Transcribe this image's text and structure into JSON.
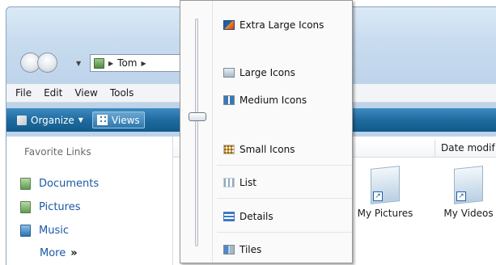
{
  "navigation": {
    "address_crumbs": [
      "Tom"
    ]
  },
  "menubar": {
    "items": [
      "File",
      "Edit",
      "View",
      "Tools"
    ]
  },
  "commandbar": {
    "organize_label": "Organize",
    "views_label": "Views"
  },
  "left_pane": {
    "header": "Favorite Links",
    "links": [
      "Documents",
      "Pictures",
      "Music"
    ],
    "more_label": "More",
    "more_arrow": "»"
  },
  "main_pane": {
    "column_date_label": "Date modif",
    "files": [
      "My Pictures",
      "My Videos"
    ]
  },
  "views_menu": {
    "items": [
      {
        "label": "Extra Large Icons",
        "icon": "extra-large-icons-icon"
      },
      {
        "label": "Large Icons",
        "icon": "large-icons-icon"
      },
      {
        "label": "Medium Icons",
        "icon": "medium-icons-icon"
      },
      {
        "label": "Small Icons",
        "icon": "small-icons-icon"
      },
      {
        "label": "List",
        "icon": "list-icon"
      },
      {
        "label": "Details",
        "icon": "details-icon"
      },
      {
        "label": "Tiles",
        "icon": "tiles-icon"
      }
    ]
  }
}
